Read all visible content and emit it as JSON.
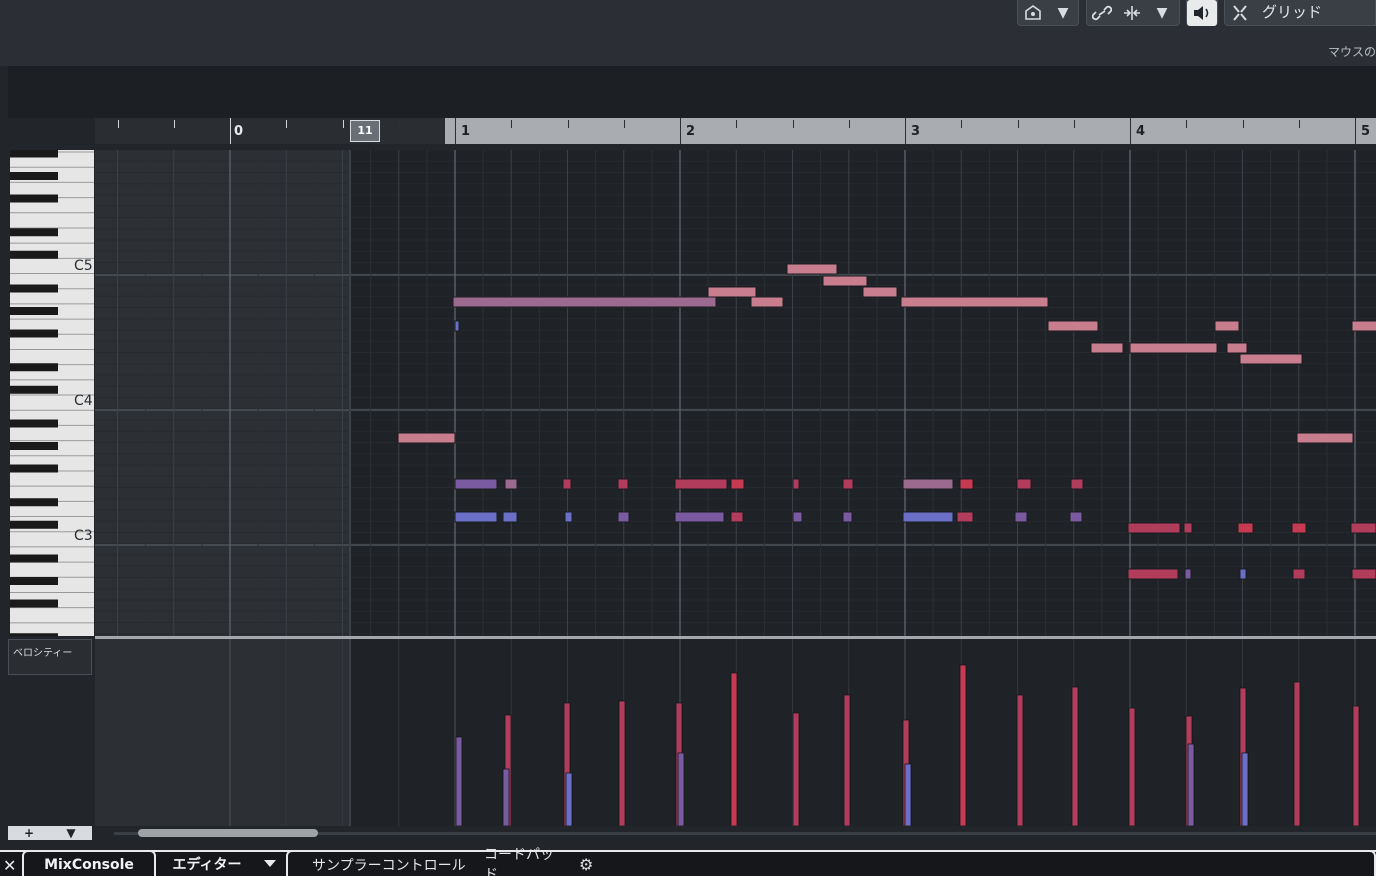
{
  "toolbar": {
    "grid_label": "グリッド",
    "mouse_label": "マウスのタ",
    "dropdown_glyph": "▼"
  },
  "ruler": {
    "bars": [
      "0",
      "1",
      "2",
      "3",
      "4",
      "5"
    ],
    "locator_label": "11"
  },
  "keyboard": {
    "labels": [
      "C5",
      "C4",
      "C3"
    ]
  },
  "velocity_lane": {
    "label": "ベロシティー"
  },
  "bottom_controls": {
    "add_label": "+",
    "menu_label": "▼"
  },
  "tabs": {
    "mixconsole": "MixConsole",
    "editor": "エディター",
    "sampler": "サンプラーコントロール",
    "chordpad": "コードパッド"
  },
  "colors": {
    "note_pink": "#c97e8f",
    "note_mauve": "#9b6a8e",
    "note_red": "#c83a52",
    "note_crimson": "#b23c5c",
    "note_purple": "#7a5aa0",
    "note_blue": "#6b6fc8",
    "ruler_active": "#a9adb1"
  }
}
